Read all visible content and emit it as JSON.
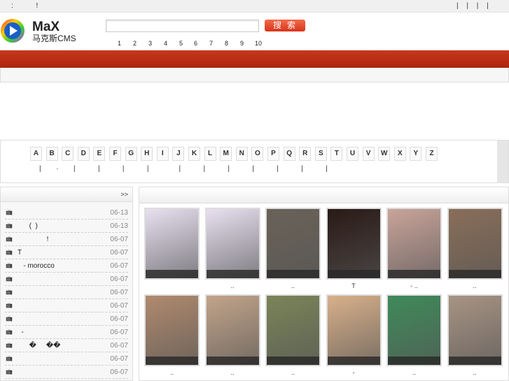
{
  "topbar": {
    "left_text": ": !",
    "right_text": "| | | |"
  },
  "logo": {
    "title": "MaX",
    "subtitle": "马克斯CMS"
  },
  "search": {
    "value": "",
    "button_label": "搜索"
  },
  "hot_numbers": [
    "1",
    "2",
    "3",
    "4",
    "5",
    "6",
    "7",
    "8",
    "9",
    "10"
  ],
  "letters": [
    "A",
    "B",
    "C",
    "D",
    "E",
    "F",
    "G",
    "H",
    "I",
    "J",
    "K",
    "L",
    "M",
    "N",
    "O",
    "P",
    "Q",
    "R",
    "S",
    "T",
    "U",
    "V",
    "W",
    "X",
    "Y",
    "Z"
  ],
  "letter_links": "|  ·  |   |   |   |    |   |   |   |   |   |   |",
  "left_panel": {
    "more_label": ">>",
    "items": [
      {
        "title": "",
        "date": "06-13"
      },
      {
        "title": "      (  )",
        "date": "06-13"
      },
      {
        "title": "               !",
        "date": "06-07"
      },
      {
        "title": "T",
        "date": "06-07"
      },
      {
        "title": "   - morocco",
        "date": "06-07"
      },
      {
        "title": "",
        "date": "06-07"
      },
      {
        "title": "",
        "date": "06-07"
      },
      {
        "title": "",
        "date": "06-07"
      },
      {
        "title": "",
        "date": "06-07"
      },
      {
        "title": "  -",
        "date": "06-07"
      },
      {
        "title": "      �     ��",
        "date": "06-07"
      },
      {
        "title": "",
        "date": "06-07"
      },
      {
        "title": "",
        "date": "06-07"
      }
    ]
  },
  "gallery": {
    "items": [
      {
        "caption": "",
        "tone": "#e8e0f0"
      },
      {
        "caption": "..",
        "tone": "#e8e0f0"
      },
      {
        "caption": "..",
        "tone": "#6a6258"
      },
      {
        "caption": "T",
        "tone": "#2a1a16"
      },
      {
        "caption": "- ..",
        "tone": "#c9a49a"
      },
      {
        "caption": "..",
        "tone": "#8a6e58"
      },
      {
        "caption": "..",
        "tone": "#b08a6e"
      },
      {
        "caption": "..",
        "tone": "#c2a48a"
      },
      {
        "caption": "..",
        "tone": "#7a8458"
      },
      {
        "caption": "-",
        "tone": "#d8b08a"
      },
      {
        "caption": "..",
        "tone": "#3f8a5a"
      },
      {
        "caption": "..",
        "tone": "#a89484"
      }
    ]
  }
}
